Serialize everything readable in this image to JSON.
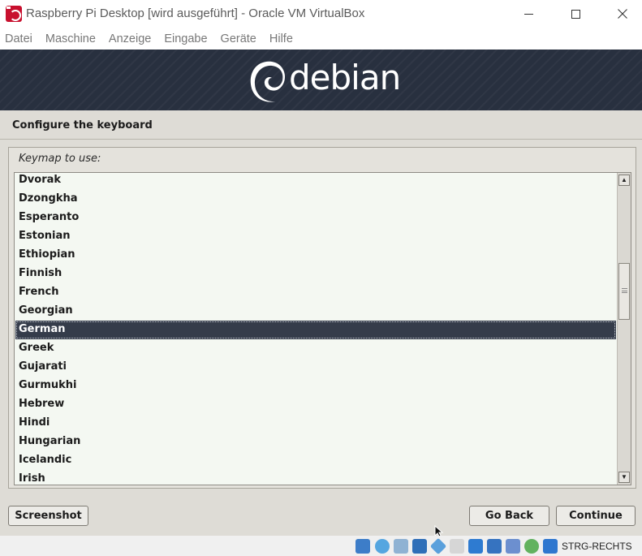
{
  "window": {
    "title": "Raspberry Pi Desktop [wird ausgeführt] - Oracle VM VirtualBox"
  },
  "menu": [
    "Datei",
    "Maschine",
    "Anzeige",
    "Eingabe",
    "Geräte",
    "Hilfe"
  ],
  "banner": {
    "logo_text": "debian"
  },
  "dialog": {
    "title": "Configure the keyboard",
    "keymap_label": "Keymap to use:",
    "keymaps": [
      "Dvorak",
      "Dzongkha",
      "Esperanto",
      "Estonian",
      "Ethiopian",
      "Finnish",
      "French",
      "Georgian",
      "German",
      "Greek",
      "Gujarati",
      "Gurmukhi",
      "Hebrew",
      "Hindi",
      "Hungarian",
      "Icelandic",
      "Irish"
    ],
    "selected": "German"
  },
  "buttons": {
    "screenshot": "Screenshot",
    "go_back": "Go Back",
    "continue": "Continue"
  },
  "statusbar": {
    "host_key": "STRG-RECHTS",
    "icons": [
      "hard-disk-icon",
      "optical-drive-icon",
      "audio-icon",
      "network-icon",
      "usb-icon",
      "shared-folder-icon",
      "display-icon",
      "recording-icon",
      "virtualization-icon",
      "mouse-integration-icon",
      "keyboard-capture-icon"
    ]
  },
  "colors": {
    "banner": "#28303f",
    "selection": "#353c4a",
    "vm_background": "#dedcd6",
    "list_background": "#f4f8f2"
  }
}
